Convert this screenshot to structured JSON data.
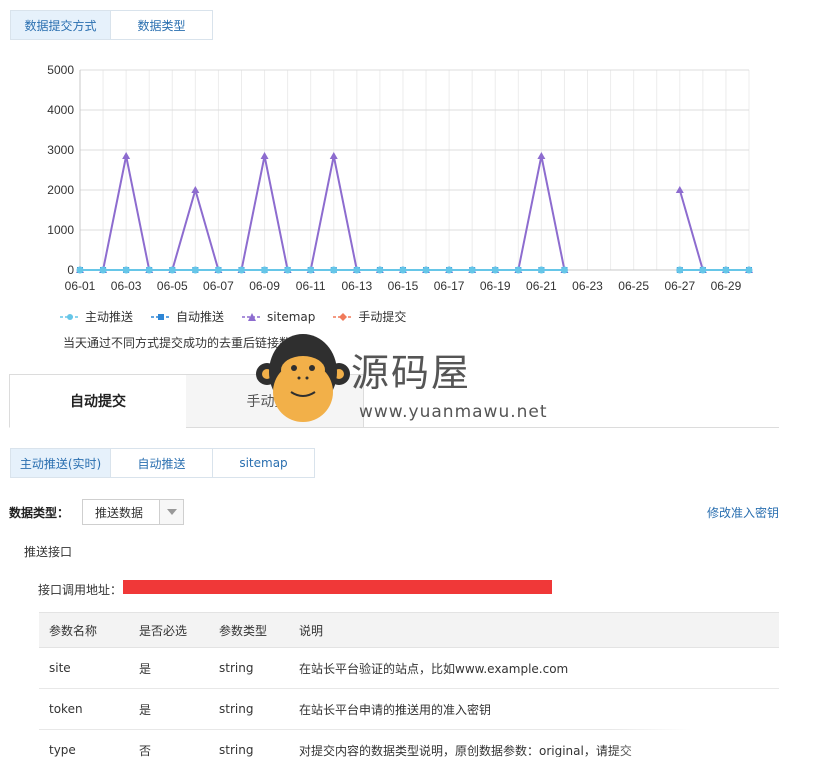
{
  "top_tabs": [
    {
      "label": "数据提交方式",
      "active": true
    },
    {
      "label": "数据类型",
      "active": false
    }
  ],
  "chart_data": {
    "type": "line",
    "ylim": [
      0,
      5000
    ],
    "yticks": [
      0,
      1000,
      2000,
      3000,
      4000,
      5000
    ],
    "x_tick_labels": [
      "06-01",
      "06-03",
      "06-05",
      "06-07",
      "06-09",
      "06-11",
      "06-13",
      "06-15",
      "06-17",
      "06-19",
      "06-21",
      "06-23",
      "06-25",
      "06-27",
      "06-29"
    ],
    "categories": [
      "06-01",
      "06-02",
      "06-03",
      "06-04",
      "06-05",
      "06-06",
      "06-07",
      "06-08",
      "06-09",
      "06-10",
      "06-11",
      "06-12",
      "06-13",
      "06-14",
      "06-15",
      "06-16",
      "06-17",
      "06-18",
      "06-19",
      "06-20",
      "06-21",
      "06-22",
      "06-23",
      "06-24",
      "06-25",
      "06-26",
      "06-27",
      "06-28",
      "06-29",
      "06-30"
    ],
    "series": [
      {
        "name": "主动推送",
        "color": "#66c6e8",
        "marker": "circle",
        "values": [
          0,
          0,
          0,
          0,
          0,
          0,
          0,
          0,
          0,
          0,
          0,
          0,
          0,
          0,
          0,
          0,
          0,
          0,
          0,
          0,
          0,
          0,
          null,
          null,
          null,
          null,
          0,
          0,
          0,
          0
        ]
      },
      {
        "name": "自动推送",
        "color": "#2e86d6",
        "marker": "square",
        "values": [
          0,
          0,
          0,
          0,
          0,
          0,
          0,
          0,
          0,
          0,
          0,
          0,
          0,
          0,
          0,
          0,
          0,
          0,
          0,
          0,
          0,
          0,
          null,
          null,
          null,
          null,
          0,
          0,
          0,
          0
        ]
      },
      {
        "name": "sitemap",
        "color": "#8d6ccf",
        "marker": "triangle",
        "values": [
          0,
          0,
          2850,
          0,
          0,
          2000,
          0,
          0,
          2850,
          0,
          0,
          2850,
          0,
          0,
          0,
          0,
          0,
          0,
          0,
          0,
          2850,
          0,
          null,
          null,
          null,
          null,
          2000,
          0,
          0,
          0
        ]
      },
      {
        "name": "手动提交",
        "color": "#f07a5a",
        "marker": "diamond",
        "values": [
          null,
          null,
          null,
          null,
          null,
          null,
          null,
          null,
          null,
          null,
          null,
          null,
          null,
          null,
          null,
          null,
          null,
          null,
          null,
          null,
          null,
          null,
          null,
          null,
          null,
          null,
          null,
          null,
          null,
          null
        ]
      }
    ],
    "grid": true,
    "legend": "bottom-left"
  },
  "note": "当天通过不同方式提交成功的去重后链接数量",
  "big_tabs": [
    {
      "label": "自动提交",
      "active": true
    },
    {
      "label": "手动提交",
      "active": false
    }
  ],
  "sub_tabs": [
    {
      "label": "主动推送(实时)",
      "active": true
    },
    {
      "label": "自动推送",
      "active": false
    },
    {
      "label": "sitemap",
      "active": false
    }
  ],
  "data_type": {
    "label": "数据类型：",
    "selected": "推送数据",
    "modify_link": "修改准入密钥"
  },
  "push_api": {
    "title": "推送接口",
    "address_label": "接口调用地址："
  },
  "params_table": {
    "headers": [
      "参数名称",
      "是否必选",
      "参数类型",
      "说明"
    ],
    "rows": [
      [
        "site",
        "是",
        "string",
        "在站长平台验证的站点，比如www.example.com"
      ],
      [
        "token",
        "是",
        "string",
        "在站长平台申请的推送用的准入密钥"
      ],
      [
        "type",
        "否",
        "string",
        "对提交内容的数据类型说明，原创数据参数：original，请提交"
      ]
    ]
  },
  "watermark": {
    "text": "源码屋",
    "url": "www.yuanmawu.net"
  }
}
